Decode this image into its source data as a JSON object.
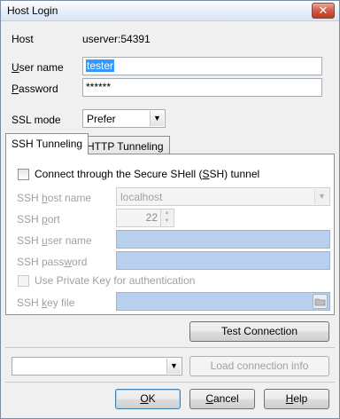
{
  "window": {
    "title": "Host Login",
    "close_glyph": "✕"
  },
  "host": {
    "label": "Host",
    "value": "userver:54391"
  },
  "username": {
    "label_underlined": "U",
    "label_rest": "ser name",
    "value": "tester"
  },
  "password": {
    "label_underlined": "P",
    "label_rest": "assword",
    "value": "******"
  },
  "ssl": {
    "label": "SSL mode",
    "value": "Prefer"
  },
  "tabs": {
    "ssh": "SSH Tunneling",
    "http": "HTTP Tunneling"
  },
  "ssh": {
    "checkbox_pre": "Connect through the Secure SHell (",
    "checkbox_u": "S",
    "checkbox_post": "SH) tunnel",
    "host_pre": "SSH ",
    "host_u": "h",
    "host_post": "ost name",
    "host_value": "localhost",
    "port_pre": "SSH ",
    "port_u": "p",
    "port_post": "ort",
    "port_value": "22",
    "user_pre": "SSH ",
    "user_u": "u",
    "user_post": "ser name",
    "password_pre": "SSH pass",
    "password_u": "w",
    "password_post": "ord",
    "private_key_label": "Use Private Key for authentication",
    "keyfile_pre": "SSH ",
    "keyfile_u": "k",
    "keyfile_post": "ey file"
  },
  "buttons": {
    "test_connection": "Test Connection",
    "load_info": "Load connection info",
    "ok_u": "O",
    "ok_rest": "K",
    "cancel_u": "C",
    "cancel_rest": "ancel",
    "help_u": "H",
    "help_rest": "elp"
  },
  "profile_select": {
    "value": ""
  }
}
